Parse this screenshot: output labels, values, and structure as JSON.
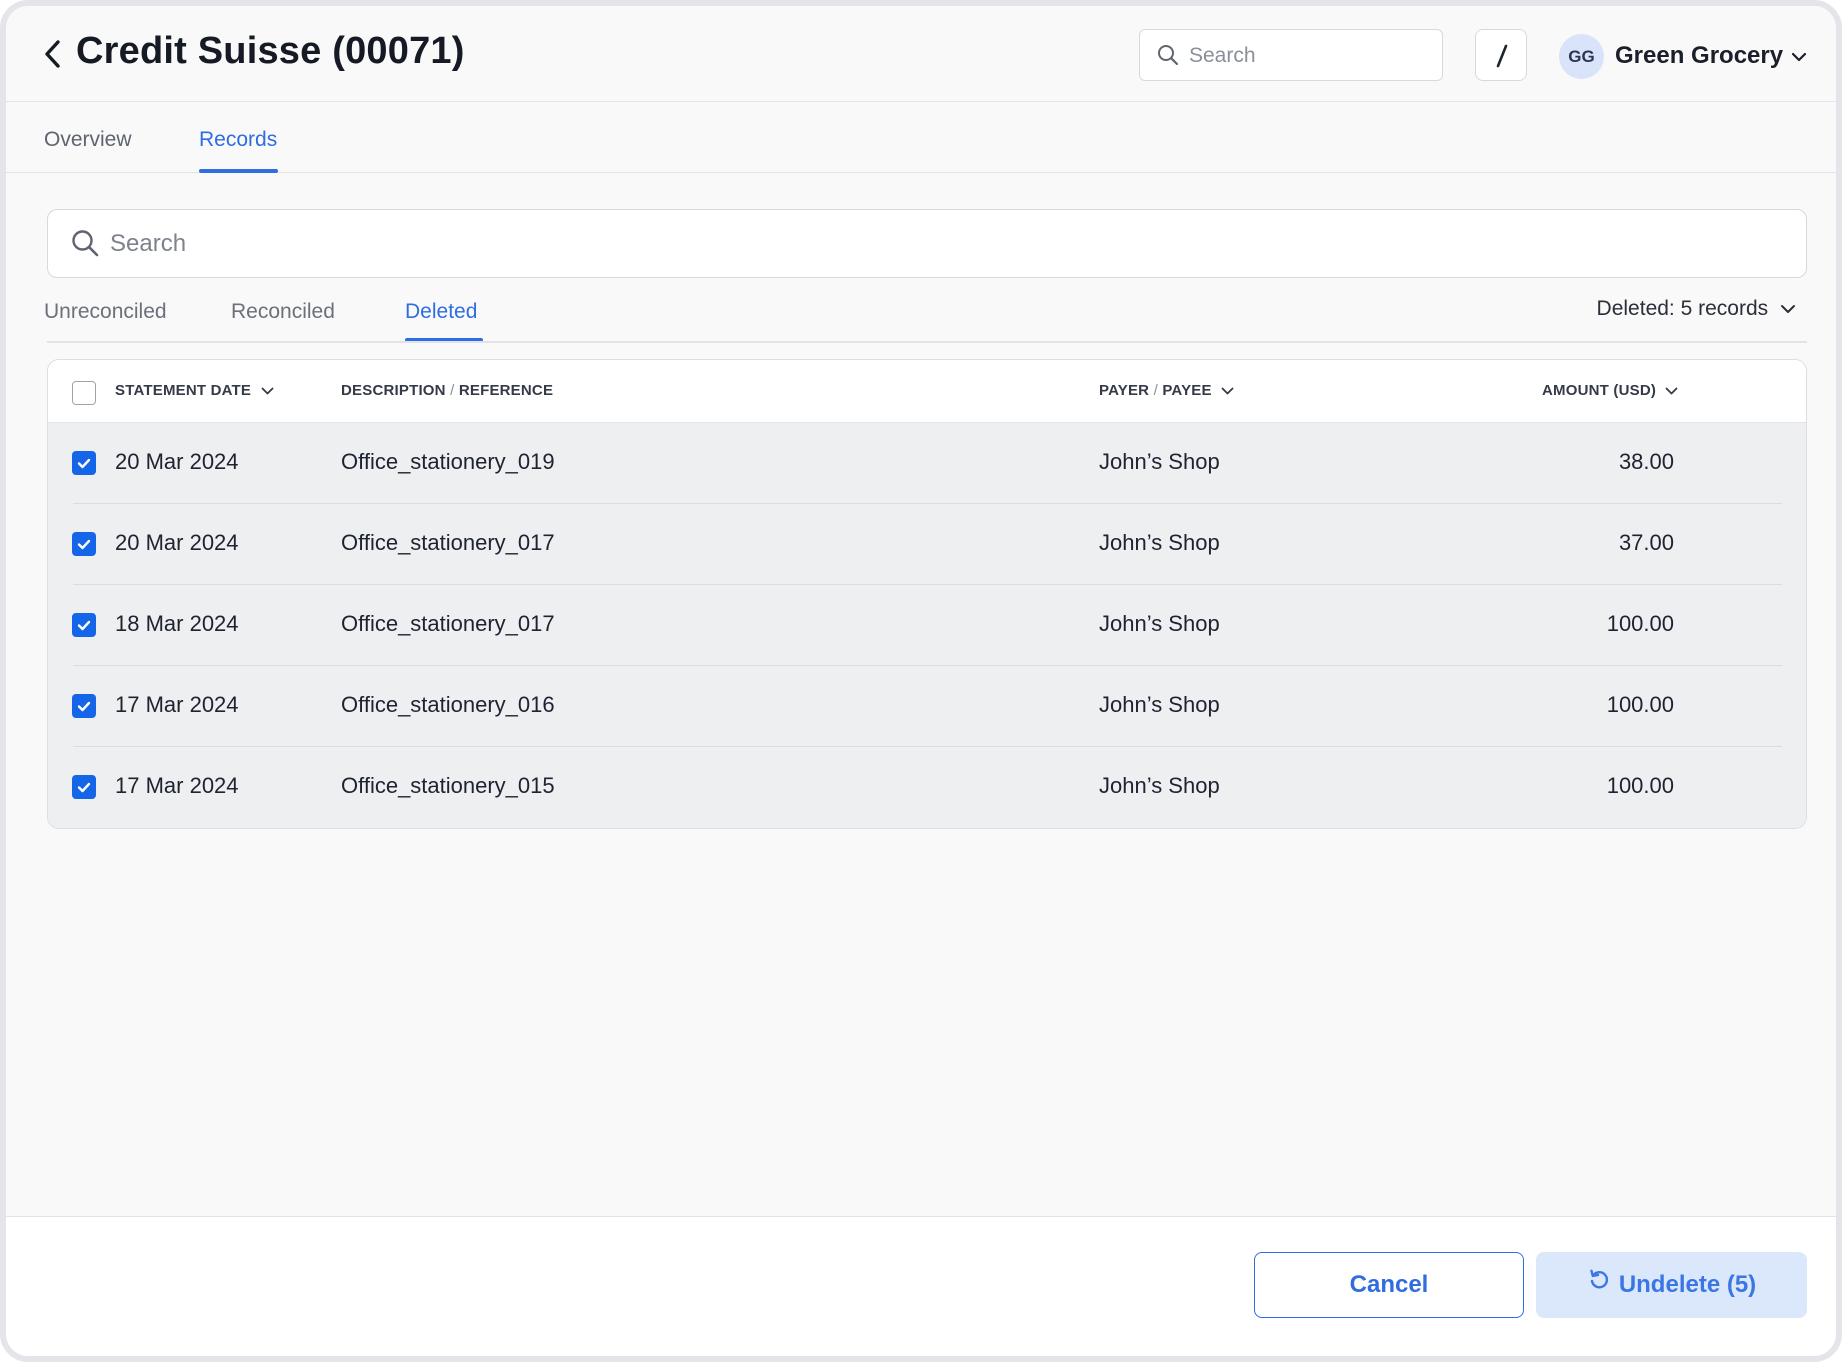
{
  "header": {
    "title": "Credit Suisse (00071)",
    "search_placeholder": "Search",
    "shortcut_key": "/",
    "avatar_initials": "GG",
    "org_name": "Green Grocery"
  },
  "main_tabs": [
    {
      "label": "Overview",
      "active": false
    },
    {
      "label": "Records",
      "active": true
    }
  ],
  "records": {
    "search_placeholder": "Search",
    "sub_tabs": [
      {
        "label": "Unreconciled",
        "active": false
      },
      {
        "label": "Reconciled",
        "active": false
      },
      {
        "label": "Deleted",
        "active": true
      }
    ],
    "summary": {
      "label": "Deleted:",
      "value": "5 records"
    },
    "columns": {
      "date": "STATEMENT DATE",
      "desc_a": "DESCRIPTION",
      "desc_sep": "/",
      "desc_b": "REFERENCE",
      "payer_a": "PAYER",
      "payer_sep": "/",
      "payer_b": "PAYEE",
      "amount": "AMOUNT (USD)"
    },
    "rows": [
      {
        "date": "20 Mar 2024",
        "description": "Office_stationery_019",
        "payee": "John’s Shop",
        "amount": "38.00",
        "checked": true
      },
      {
        "date": "20 Mar 2024",
        "description": "Office_stationery_017",
        "payee": "John’s Shop",
        "amount": "37.00",
        "checked": true
      },
      {
        "date": "18 Mar 2024",
        "description": "Office_stationery_017",
        "payee": "John’s Shop",
        "amount": "100.00",
        "checked": true
      },
      {
        "date": "17 Mar 2024",
        "description": "Office_stationery_016",
        "payee": "John’s Shop",
        "amount": "100.00",
        "checked": true
      },
      {
        "date": "17 Mar 2024",
        "description": "Office_stationery_015",
        "payee": "John’s Shop",
        "amount": "100.00",
        "checked": true
      }
    ]
  },
  "footer": {
    "cancel_label": "Cancel",
    "undelete_label": "Undelete (5)"
  },
  "colors": {
    "accent": "#2f6de1",
    "checkbox": "#1565e8",
    "undelete_bg": "#dbe7fb"
  }
}
